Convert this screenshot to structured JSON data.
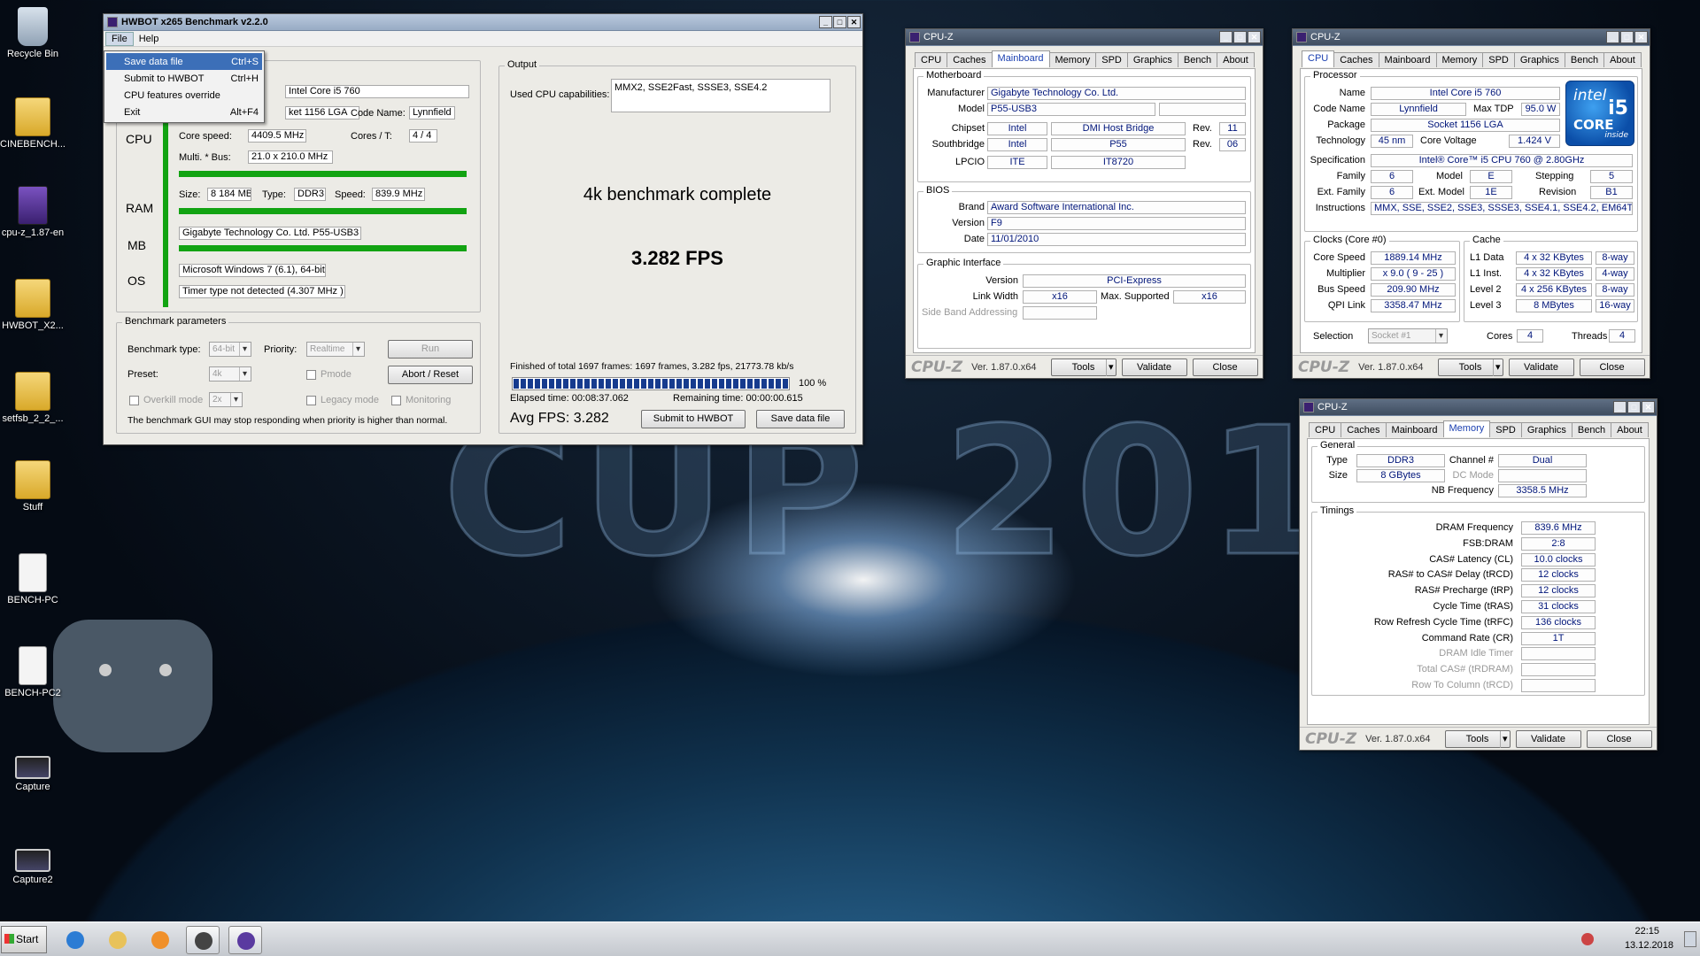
{
  "desktop": {
    "icons": [
      {
        "label": "Recycle Bin",
        "icon": "recycle-bin-icon"
      },
      {
        "label": "CINEBENCH...",
        "icon": "folder-icon"
      },
      {
        "label": "cpu-z_1.87-en",
        "icon": "cpuz-installer-icon"
      },
      {
        "label": "HWBOT_X2...",
        "icon": "folder-icon"
      },
      {
        "label": "setfsb_2_2_...",
        "icon": "folder-icon"
      },
      {
        "label": "Stuff",
        "icon": "folder-icon"
      },
      {
        "label": "BENCH-PC",
        "icon": "text-file-icon"
      },
      {
        "label": "BENCH-PC2",
        "icon": "text-file-icon"
      },
      {
        "label": "Capture",
        "icon": "screenshot-icon"
      },
      {
        "label": "Capture2",
        "icon": "screenshot-icon"
      }
    ],
    "wallpaper_text": "CUP 2018"
  },
  "hwbot": {
    "title": "HWBOT x265 Benchmark v2.2.0",
    "menu": [
      "File",
      "Help"
    ],
    "file_menu": [
      {
        "label": "Save data file",
        "shortcut": "Ctrl+S"
      },
      {
        "label": "Submit to HWBOT",
        "shortcut": "Ctrl+H"
      },
      {
        "label": "CPU features override",
        "shortcut": ""
      },
      {
        "label": "Exit",
        "shortcut": "Alt+F4"
      }
    ],
    "cpu": {
      "section": "CPU",
      "name": "Intel Core i5 760",
      "socket": "ket 1156 LGA",
      "codename_label": "Code Name:",
      "codename": "Lynnfield",
      "speed_label": "Core speed:",
      "speed": "4409.5 MHz",
      "cores_label": "Cores / T:",
      "cores": "4 / 4",
      "mult_label": "Multi. * Bus:",
      "mult": "21.0 x 210.0 MHz"
    },
    "ram": {
      "section": "RAM",
      "size_label": "Size:",
      "size": "8 184 MB",
      "type_label": "Type:",
      "type": "DDR3",
      "speed_label": "Speed:",
      "speed": "839.9 MHz"
    },
    "mb": {
      "section": "MB",
      "value": "Gigabyte Technology Co. Ltd. P55-USB3"
    },
    "os": {
      "section": "OS",
      "value": "Microsoft Windows 7 (6.1), 64-bit",
      "timer": "Timer type not detected (4.307 MHz )"
    },
    "params": {
      "title": "Benchmark parameters",
      "type_label": "Benchmark type:",
      "type": "64-bit",
      "priority_label": "Priority:",
      "priority": "Realtime",
      "run": "Run",
      "preset_label": "Preset:",
      "preset": "4k",
      "pmode": "Pmode",
      "abort": "Abort / Reset",
      "overkill": "Overkill mode",
      "overkill_val": "2x",
      "legacy": "Legacy mode",
      "monitoring": "Monitoring",
      "warning": "The benchmark GUI may stop responding when priority is higher than normal."
    },
    "output": {
      "title": "Output",
      "caps_label": "Used CPU capabilities:",
      "caps": "MMX2, SSE2Fast, SSSE3, SSE4.2",
      "status": "4k benchmark complete",
      "fps": "3.282 FPS",
      "finished": "Finished of total 1697 frames: 1697 frames, 3.282 fps,  21773.78 kb/s",
      "progress": 1.0,
      "percent": "100 %",
      "elapsed": "Elapsed time: 00:08:37.062",
      "remaining": "Remaining time: 00:00:00.615",
      "avg": "Avg FPS: 3.282",
      "submit": "Submit to HWBOT",
      "save": "Save data file"
    }
  },
  "cpuz_mb": {
    "title": "CPU-Z",
    "tabs": [
      "CPU",
      "Caches",
      "Mainboard",
      "Memory",
      "SPD",
      "Graphics",
      "Bench",
      "About"
    ],
    "active": "Mainboard",
    "motherboard": {
      "title": "Motherboard",
      "manufacturer_label": "Manufacturer",
      "manufacturer": "Gigabyte Technology Co. Ltd.",
      "model_label": "Model",
      "model": "P55-USB3",
      "chipset_label": "Chipset",
      "chipset_vendor": "Intel",
      "chipset": "DMI Host Bridge",
      "rev_label": "Rev.",
      "chipset_rev": "11",
      "south_label": "Southbridge",
      "south_vendor": "Intel",
      "south": "P55",
      "south_rev": "06",
      "lpcio_label": "LPCIO",
      "lpcio_vendor": "ITE",
      "lpcio": "IT8720"
    },
    "bios": {
      "title": "BIOS",
      "brand_label": "Brand",
      "brand": "Award Software International Inc.",
      "version_label": "Version",
      "version": "F9",
      "date_label": "Date",
      "date": "11/01/2010"
    },
    "graphic": {
      "title": "Graphic Interface",
      "version_label": "Version",
      "version": "PCI-Express",
      "width_label": "Link Width",
      "width": "x16",
      "max_label": "Max. Supported",
      "max": "x16",
      "sideband": "Side Band Addressing"
    },
    "footer": {
      "logo": "CPU-Z",
      "version": "Ver. 1.87.0.x64",
      "tools": "Tools",
      "validate": "Validate",
      "close": "Close"
    }
  },
  "cpuz_cpu": {
    "title": "CPU-Z",
    "tabs": [
      "CPU",
      "Caches",
      "Mainboard",
      "Memory",
      "SPD",
      "Graphics",
      "Bench",
      "About"
    ],
    "active": "CPU",
    "processor": {
      "title": "Processor",
      "name_label": "Name",
      "name": "Intel Core i5 760",
      "codename_label": "Code Name",
      "codename": "Lynnfield",
      "tdp_label": "Max TDP",
      "tdp": "95.0 W",
      "package_label": "Package",
      "package": "Socket 1156 LGA",
      "tech_label": "Technology",
      "tech": "45 nm",
      "voltage_label": "Core Voltage",
      "voltage": "1.424 V",
      "spec_label": "Specification",
      "spec": "Intel® Core™ i5 CPU      760  @ 2.80GHz",
      "family_label": "Family",
      "family": "6",
      "model_label": "Model",
      "model": "E",
      "stepping_label": "Stepping",
      "stepping": "5",
      "extfamily_label": "Ext. Family",
      "extfamily": "6",
      "extmodel_label": "Ext. Model",
      "extmodel": "1E",
      "revision_label": "Revision",
      "revision": "B1",
      "instr_label": "Instructions",
      "instr": "MMX, SSE, SSE2, SSE3, SSSE3, SSE4.1, SSE4.2, EM64T, VT-x"
    },
    "badge": {
      "brand": "intel",
      "line": "CORE",
      "model": "i5",
      "inside": "inside"
    },
    "clocks": {
      "title": "Clocks (Core #0)",
      "speed_label": "Core Speed",
      "speed": "1889.14 MHz",
      "mult_label": "Multiplier",
      "mult": "x 9.0 ( 9 - 25 )",
      "bus_label": "Bus Speed",
      "bus": "209.90 MHz",
      "qpi_label": "QPI Link",
      "qpi": "3358.47 MHz"
    },
    "cache": {
      "title": "Cache",
      "l1d_label": "L1 Data",
      "l1d": "4 x 32 KBytes",
      "l1d_way": "8-way",
      "l1i_label": "L1 Inst.",
      "l1i": "4 x 32 KBytes",
      "l1i_way": "4-way",
      "l2_label": "Level 2",
      "l2": "4 x 256 KBytes",
      "l2_way": "8-way",
      "l3_label": "Level 3",
      "l3": "8 MBytes",
      "l3_way": "16-way"
    },
    "selection": {
      "label": "Selection",
      "value": "Socket #1",
      "cores_label": "Cores",
      "cores": "4",
      "threads_label": "Threads",
      "threads": "4"
    },
    "footer": {
      "logo": "CPU-Z",
      "version": "Ver. 1.87.0.x64",
      "tools": "Tools",
      "validate": "Validate",
      "close": "Close"
    }
  },
  "cpuz_mem": {
    "title": "CPU-Z",
    "tabs": [
      "CPU",
      "Caches",
      "Mainboard",
      "Memory",
      "SPD",
      "Graphics",
      "Bench",
      "About"
    ],
    "active": "Memory",
    "general": {
      "title": "General",
      "type_label": "Type",
      "type": "DDR3",
      "channel_label": "Channel #",
      "channel": "Dual",
      "size_label": "Size",
      "size": "8 GBytes",
      "dcmode_label": "DC Mode",
      "nb_label": "NB Frequency",
      "nb": "3358.5 MHz"
    },
    "timings": {
      "title": "Timings",
      "rows": [
        {
          "label": "DRAM Frequency",
          "value": "839.6 MHz",
          "dim": false
        },
        {
          "label": "FSB:DRAM",
          "value": "2:8",
          "dim": false
        },
        {
          "label": "CAS# Latency (CL)",
          "value": "10.0 clocks",
          "dim": false
        },
        {
          "label": "RAS# to CAS# Delay (tRCD)",
          "value": "12 clocks",
          "dim": false
        },
        {
          "label": "RAS# Precharge (tRP)",
          "value": "12 clocks",
          "dim": false
        },
        {
          "label": "Cycle Time (tRAS)",
          "value": "31 clocks",
          "dim": false
        },
        {
          "label": "Row Refresh Cycle Time (tRFC)",
          "value": "136 clocks",
          "dim": false
        },
        {
          "label": "Command Rate (CR)",
          "value": "1T",
          "dim": false
        },
        {
          "label": "DRAM Idle Timer",
          "value": "",
          "dim": true
        },
        {
          "label": "Total CAS# (tRDRAM)",
          "value": "",
          "dim": true
        },
        {
          "label": "Row To Column (tRCD)",
          "value": "",
          "dim": true
        }
      ]
    },
    "footer": {
      "logo": "CPU-Z",
      "version": "Ver. 1.87.0.x64",
      "tools": "Tools",
      "validate": "Validate",
      "close": "Close"
    }
  },
  "taskbar": {
    "start": "Start",
    "time": "22:15",
    "date": "13.12.2018",
    "apps": [
      "internet-explorer-icon",
      "explorer-icon",
      "media-player-icon",
      "hwbot-icon",
      "cpuz-icon"
    ]
  }
}
